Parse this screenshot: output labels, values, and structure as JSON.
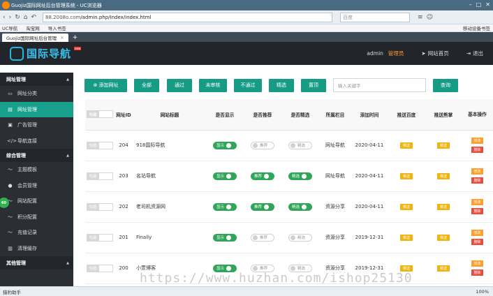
{
  "browser": {
    "window_title": "Guojiz国际网址后台管理系统 - UC浏览器",
    "url_dim": "88.2008o.com",
    "url_path": "/admin.php/Index/index.html",
    "search_placeholder": "百度",
    "bookmarks": [
      "UC导航",
      "淘宝网",
      "导入书签"
    ],
    "bookmarks_right": "移动设备书签",
    "tab_title": "Guojiz国际网址后台管理",
    "status_left": "猎豹助手",
    "zoom": "100%"
  },
  "app": {
    "brand": "国际导航",
    "brand_badge": "new",
    "user": "admin",
    "role": "管理员",
    "home_link": "网站首页",
    "logout": "退出"
  },
  "sidebar": {
    "sections": [
      {
        "title": "网址管理",
        "items": [
          {
            "label": "网址分类",
            "icon": "monitor-icon"
          },
          {
            "label": "网址管理",
            "icon": "list-icon",
            "active": true
          },
          {
            "label": "广告管理",
            "icon": "image-icon"
          },
          {
            "label": "导航连接",
            "icon": "code-icon"
          }
        ]
      },
      {
        "title": "综合管理",
        "items": [
          {
            "label": "主题模板",
            "icon": "pulse-icon"
          },
          {
            "label": "会员管理",
            "icon": "user-icon"
          },
          {
            "label": "网站配置",
            "icon": "pulse-icon"
          },
          {
            "label": "积分配置",
            "icon": "pulse-icon"
          },
          {
            "label": "充值记录",
            "icon": "pulse-icon"
          },
          {
            "label": "清理缓存",
            "icon": "trash-icon"
          }
        ]
      },
      {
        "title": "其他管理",
        "items": []
      }
    ],
    "bubble": "60"
  },
  "toolbar": {
    "add": "添加网址",
    "all": "全部",
    "pass": "通过",
    "unreviewed": "未审核",
    "fail": "不通过",
    "selected": "精选",
    "top": "置顶",
    "keyword_placeholder": "输入关键字",
    "query": "查询"
  },
  "table": {
    "headers": {
      "check": "勾选",
      "id": "网址ID",
      "title": "网站标题",
      "show": "是否显示",
      "recommend": "是否推荐",
      "featured": "是否精选",
      "column": "所属栏目",
      "date": "添加时间",
      "push_baidu": "推送百度",
      "push_xz": "推送熊掌",
      "ops": "基本操作"
    },
    "check_label": "勾选",
    "rows": [
      {
        "id": "204",
        "title": "918国际导航",
        "show": {
          "label": "显示",
          "on": true
        },
        "rec": {
          "label": "推荐",
          "on": false
        },
        "feat": {
          "label": "精选",
          "on": false
        },
        "column": "网址导航",
        "date": "2020-04-11",
        "push_baidu": "推送",
        "push_xz": "推送",
        "edit": "修改",
        "del": "删除"
      },
      {
        "id": "203",
        "title": "名站导航",
        "show": {
          "label": "显示",
          "on": true
        },
        "rec": {
          "label": "推荐",
          "on": true
        },
        "feat": {
          "label": "精选",
          "on": true
        },
        "column": "网址导航",
        "date": "2020-04-11",
        "push_baidu": "推送",
        "push_xz": "推送",
        "edit": "修改",
        "del": "删除"
      },
      {
        "id": "202",
        "title": "老司机资源网",
        "show": {
          "label": "显示",
          "on": true
        },
        "rec": {
          "label": "推荐",
          "on": true
        },
        "feat": {
          "label": "精选",
          "on": true
        },
        "column": "资源分享",
        "date": "2020-04-11",
        "push_baidu": "推送",
        "push_xz": "推送",
        "edit": "修改",
        "del": "删除"
      },
      {
        "id": "201",
        "title": "Finally",
        "show": {
          "label": "显示",
          "on": true
        },
        "rec": {
          "label": "推荐",
          "on": false
        },
        "feat": {
          "label": "精选",
          "on": false
        },
        "column": "资源分享",
        "date": "2019-12-31",
        "push_baidu": "推送",
        "push_xz": "推送",
        "edit": "修改",
        "del": "删除"
      },
      {
        "id": "200",
        "title": "小萱博客",
        "show": {
          "label": "显示",
          "on": true
        },
        "rec": {
          "label": "推荐",
          "on": false
        },
        "feat": {
          "label": "精选",
          "on": false
        },
        "column": "资源分享",
        "date": "2019-12-31",
        "push_baidu": "推送",
        "push_xz": "推送",
        "edit": "修改",
        "del": "删除"
      }
    ]
  },
  "watermark": "https://www.huzhan.com/ishop25130",
  "colors": {
    "accent": "#169c86",
    "sidebar": "#2b2f34",
    "header": "#22262b",
    "brand": "#39c0ec",
    "switch_on": "#31a65b",
    "push": "#f1b30e",
    "edit": "#ff9f2a",
    "delete": "#e94b3c"
  }
}
